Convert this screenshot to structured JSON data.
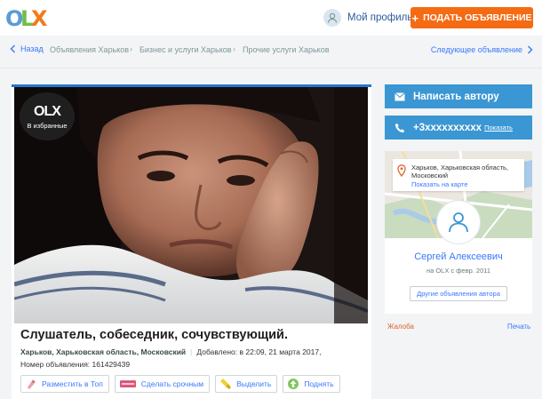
{
  "header": {
    "logo": {
      "letters": [
        "O",
        "L",
        "X"
      ],
      "colors": [
        "#5b9bd5",
        "#6fbf4a",
        "#f27a1a"
      ]
    },
    "profile_label": "Мой профиль",
    "post_button": {
      "plus": "+",
      "label": "ПОДАТЬ ОБЪЯВЛЕНИЕ"
    }
  },
  "breadcrumb": {
    "back_label": "Назад",
    "items": [
      "Объявления Харьков",
      "Бизнес и услуги Харьков",
      "Прочие услуги Харьков"
    ],
    "next_label": "Следующее объявление"
  },
  "ad": {
    "favorite_badge": {
      "logo_text": "OLX",
      "label": "В избранные"
    },
    "title": "Слушатель, собеседник, сочувствующий.",
    "location": "Харьков, Харьковская область, Московский",
    "added": "Добавлено: в 22:09, 21 марта 2017,",
    "ad_number": "Номер объявления: 161429439",
    "promo_buttons": [
      {
        "label": "Разместить в Топ",
        "icon": "rocket-icon"
      },
      {
        "label": "Сделать срочным",
        "icon": "urgent-tag-icon"
      },
      {
        "label": "Выделить",
        "icon": "highlighter-icon"
      },
      {
        "label": "Поднять",
        "icon": "up-arrow-icon"
      }
    ]
  },
  "contact": {
    "write_label": "Написать автору",
    "phone": "+3xxxxxxxxxx",
    "show_label": "Показать"
  },
  "seller": {
    "address": "Харьков, Харьковская область, Московский",
    "map_link": "Показать на карте",
    "name": "Сергей Алексеевич",
    "since": "на OLX с февр. 2011",
    "other_ads": "Другие объявления автора"
  },
  "footer_links": {
    "complaint": "Жалоба",
    "print": "Печать"
  },
  "colors": {
    "accent_orange": "#f56b14",
    "contact_blue": "#3b97d3",
    "link_blue": "#3a77ff",
    "top_bar": "#2377cf",
    "complaint": "#e1632b"
  }
}
